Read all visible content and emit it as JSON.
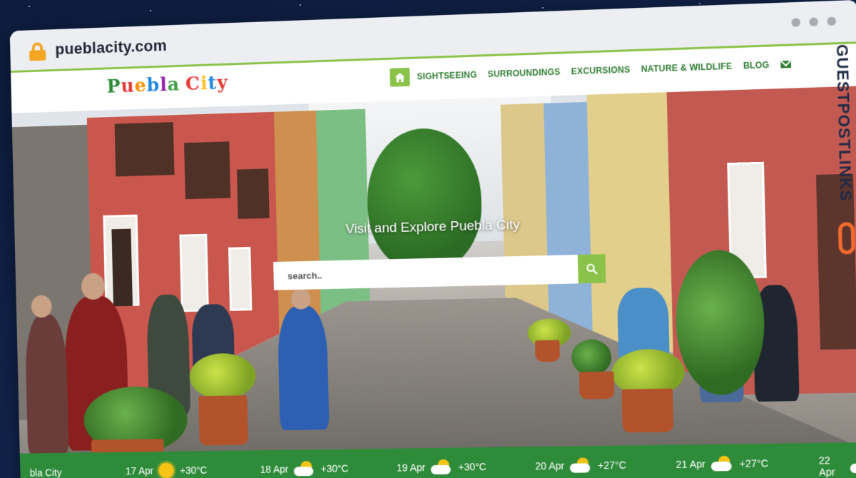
{
  "browser": {
    "url": "pueblacity.com"
  },
  "site": {
    "logo_text": "Puebla City",
    "logo_colors": [
      "#2e8b3a",
      "#e53935",
      "#fb8c00",
      "#1e88e5",
      "#8e24aa",
      "#43a047",
      "#e53935",
      "#fbc02d",
      "#1e88e5",
      "#e53935",
      "#43a047"
    ],
    "nav": [
      {
        "label": "SIGHTSEEING"
      },
      {
        "label": "SURROUNDINGS"
      },
      {
        "label": "EXCURSIONS"
      },
      {
        "label": "NATURE & WILDLIFE"
      },
      {
        "label": "BLOG"
      }
    ],
    "accent_color": "#8bc34a",
    "nav_color": "#2e7d32"
  },
  "hero": {
    "title": "Visit and Explore Puebla City",
    "search_placeholder": "search.."
  },
  "weather": {
    "city": "bla City",
    "days": [
      {
        "date": "17 Apr",
        "icon": "sun-icon",
        "temp": "+30°C"
      },
      {
        "date": "18 Apr",
        "icon": "cloud-sun-icon",
        "temp": "+30°C"
      },
      {
        "date": "19 Apr",
        "icon": "cloud-sun-icon",
        "temp": "+30°C"
      },
      {
        "date": "20 Apr",
        "icon": "cloud-rain-icon",
        "temp": "+27°C"
      },
      {
        "date": "21 Apr",
        "icon": "cloud-sun-icon",
        "temp": "+27°C"
      },
      {
        "date": "22 Apr",
        "icon": "cloud-sun-icon",
        "temp": ""
      }
    ]
  },
  "watermark": {
    "text": "GUESTPOSTLINKS"
  }
}
